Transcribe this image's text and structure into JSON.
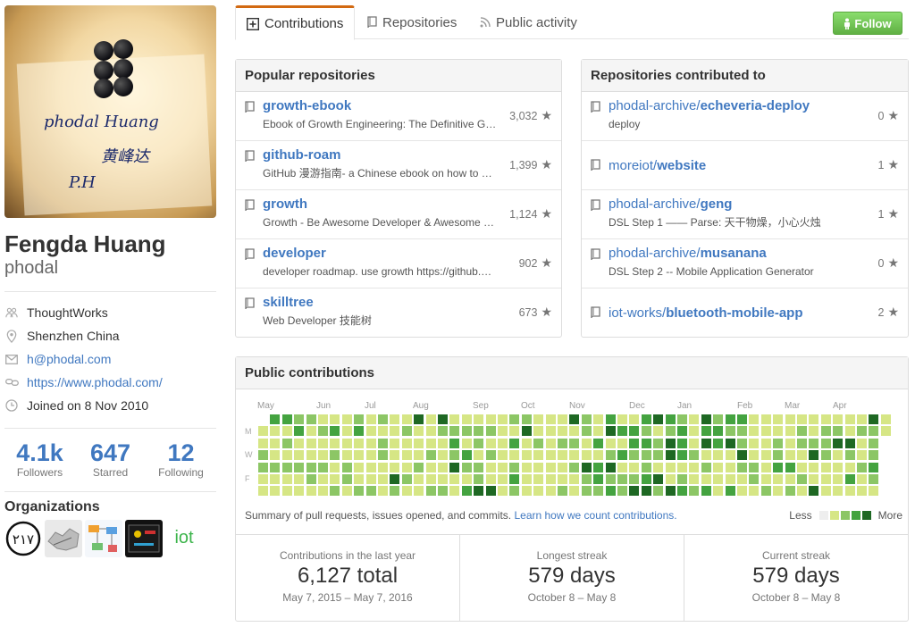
{
  "profile": {
    "fullname": "Fengda Huang",
    "username": "phodal",
    "company": "ThoughtWorks",
    "location": "Shenzhen China",
    "email": "h@phodal.com",
    "website": "https://www.phodal.com/",
    "joined": "Joined on 8 Nov 2010",
    "avatar_signature": [
      "phodal Huang",
      "黄峰达",
      "P.H"
    ]
  },
  "stats": [
    {
      "value": "4.1k",
      "label": "Followers"
    },
    {
      "value": "647",
      "label": "Starred"
    },
    {
      "value": "12",
      "label": "Following"
    }
  ],
  "organizations": {
    "title": "Organizations",
    "items": [
      {
        "name": "org-217",
        "text": "٢١٧"
      },
      {
        "name": "org-map"
      },
      {
        "name": "org-diagram"
      },
      {
        "name": "org-dark"
      },
      {
        "name": "org-iot",
        "text": "iot"
      }
    ]
  },
  "tabs": [
    {
      "label": "Contributions",
      "icon": "plus-square-icon",
      "selected": true
    },
    {
      "label": "Repositories",
      "icon": "repo-icon",
      "selected": false
    },
    {
      "label": "Public activity",
      "icon": "rss-icon",
      "selected": false
    }
  ],
  "follow_button": "Follow",
  "popular": {
    "title": "Popular repositories",
    "repos": [
      {
        "name": "growth-ebook",
        "desc": "Ebook of Growth Engineering: The Definitive G…",
        "stars": "3,032"
      },
      {
        "name": "github-roam",
        "desc": "GitHub 漫游指南- a Chinese ebook on how to …",
        "stars": "1,399"
      },
      {
        "name": "growth",
        "desc": "Growth - Be Awesome Developer & Awesome …",
        "stars": "1,124"
      },
      {
        "name": "developer",
        "desc": "developer roadmap. use growth https://github.…",
        "stars": "902"
      },
      {
        "name": "skilltree",
        "desc": "Web Developer 技能树",
        "stars": "673"
      }
    ]
  },
  "contributed": {
    "title": "Repositories contributed to",
    "repos": [
      {
        "owner": "phodal-archive/",
        "name": "echeveria-deploy",
        "desc": "deploy",
        "stars": "0"
      },
      {
        "owner": "moreiot/",
        "name": "website",
        "desc": "",
        "stars": "1"
      },
      {
        "owner": "phodal-archive/",
        "name": "geng",
        "desc": "DSL Step 1 —— Parse: 天干物燥，小心火烛",
        "stars": "1"
      },
      {
        "owner": "phodal-archive/",
        "name": "musanana",
        "desc": "DSL Step 2 -- Mobile Application Generator",
        "stars": "0"
      },
      {
        "owner": "iot-works/",
        "name": "bluetooth-mobile-app",
        "desc": "",
        "stars": "2"
      }
    ]
  },
  "contributions": {
    "title": "Public contributions",
    "months": [
      "May",
      "Jun",
      "Jul",
      "Aug",
      "Sep",
      "Oct",
      "Nov",
      "Dec",
      "Jan",
      "Feb",
      "Mar",
      "Apr"
    ],
    "day_labels": [
      "M",
      "W",
      "F"
    ],
    "summary_text": "Summary of pull requests, issues opened, and commits.",
    "learn_link": "Learn how we count contributions.",
    "legend_less": "Less",
    "legend_more": "More",
    "colors": [
      "#eeeeee",
      "#d6e685",
      "#8cc665",
      "#44a340",
      "#1e6823"
    ],
    "streaks": [
      {
        "title": "Contributions in the last year",
        "value": "6,127 total",
        "range": "May 7, 2015 – May 7, 2016"
      },
      {
        "title": "Longest streak",
        "value": "579 days",
        "range": "October 8 – May 8"
      },
      {
        "title": "Current streak",
        "value": "579 days",
        "range": "October 8 – May 8"
      }
    ]
  }
}
